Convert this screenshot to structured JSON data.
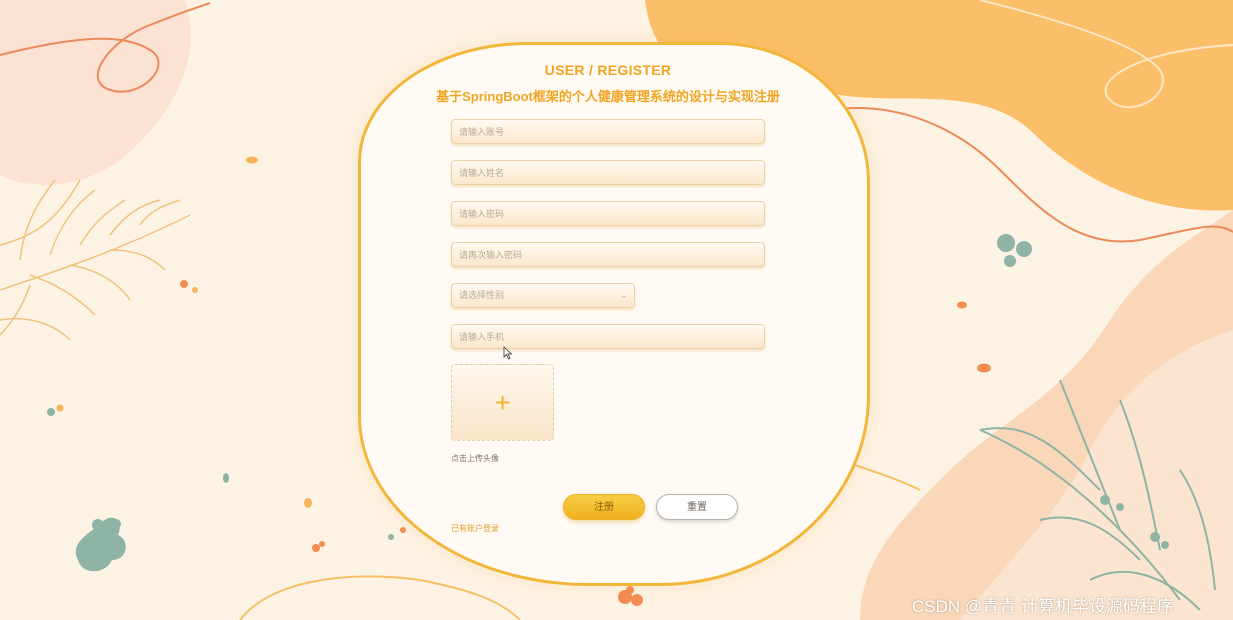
{
  "page": {
    "title_en": "USER / REGISTER",
    "title_cn": "基于SpringBoot框架的个人健康管理系统的设计与实现注册"
  },
  "form": {
    "fields": [
      {
        "name": "account",
        "placeholder": "请输入账号",
        "value": ""
      },
      {
        "name": "name",
        "placeholder": "请输入姓名",
        "value": ""
      },
      {
        "name": "password",
        "placeholder": "请输入密码",
        "value": ""
      },
      {
        "name": "confirm",
        "placeholder": "请再次输入密码",
        "value": ""
      },
      {
        "name": "phone",
        "placeholder": "请输入手机",
        "value": ""
      }
    ],
    "gender_select": {
      "placeholder": "请选择性别",
      "icon": "chevron-down-icon"
    },
    "upload": {
      "icon": "plus-icon",
      "label": "点击上传头像"
    },
    "login_link": "已有账户登录",
    "submit_label": "注册",
    "reset_label": "重置"
  },
  "watermark": "CSDN @青青  计算机毕设源码程序",
  "colors": {
    "background": "#fdf3e4",
    "accent": "#f0a523",
    "card_border": "#f2b73a",
    "orange_blob": "#fbbf6a",
    "peach_blob": "#f8d8bd",
    "sage_leaf": "#8fb3a4"
  }
}
